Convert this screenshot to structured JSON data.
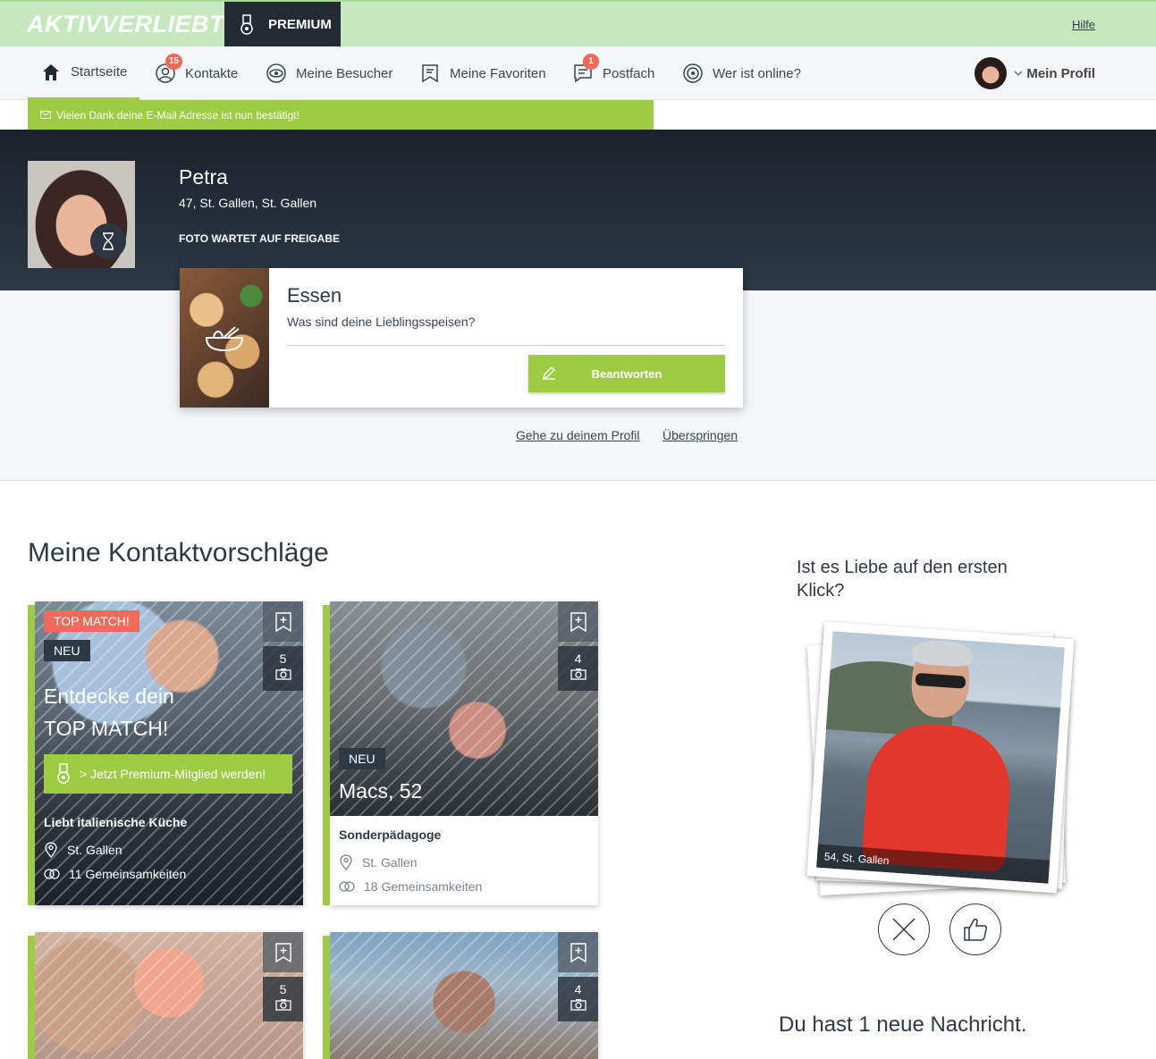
{
  "header": {
    "logo": "AKTIVVERLIEBT",
    "premium_tab": "PREMIUM",
    "help": "Hilfe"
  },
  "nav": {
    "items": [
      {
        "label": "Startseite",
        "icon": "home-icon",
        "active": true
      },
      {
        "label": "Kontakte",
        "icon": "contacts-icon",
        "badge": "15"
      },
      {
        "label": "Meine Besucher",
        "icon": "eye-icon"
      },
      {
        "label": "Meine Favoriten",
        "icon": "bookmark-icon"
      },
      {
        "label": "Postfach",
        "icon": "message-icon",
        "badge": "1"
      },
      {
        "label": "Wer ist online?",
        "icon": "radar-icon"
      }
    ],
    "profile_menu": "Mein Profil"
  },
  "notice": "Vielen Dank deine E-Mail Adresse ist nun bestätigt!",
  "profile": {
    "name": "Petra",
    "location": "47, St. Gallen, St. Gallen",
    "status": "FOTO WARTET AUF FREIGABE"
  },
  "question": {
    "title": "Essen",
    "text": "Was sind deine Lieblingsspeisen?",
    "answer_label": "Beantworten"
  },
  "links": {
    "go_profile": "Gehe zu deinem Profil",
    "skip": "Überspringen"
  },
  "suggestions": {
    "title": "Meine Kontaktvorschläge",
    "cards": [
      {
        "tag_top": "TOP MATCH!",
        "tag_new": "NEU",
        "photo_count": "5",
        "promo_line1": "Entdecke dein",
        "promo_line2": "TOP MATCH!",
        "cta": "> Jetzt Premium-Mitglied werden!",
        "headline": "Liebt italienische Küche",
        "city": "St. Gallen",
        "commonalities": "11 Gemeinsamkeiten"
      },
      {
        "tag_new": "NEU",
        "photo_count": "4",
        "name": "Macs, 52",
        "headline": "Sonderpädagoge",
        "city": "St. Gallen",
        "commonalities": "18 Gemeinsamkeiten"
      },
      {
        "photo_count": "5"
      },
      {
        "photo_count": "4"
      }
    ]
  },
  "love_at_first_click": {
    "title": "Ist es Liebe auf den ersten Klick?",
    "caption": "54, St. Gallen",
    "no_icon": "close-icon",
    "yes_icon": "thumbs-up-icon"
  },
  "messages": {
    "text": "Du hast 1 neue Nachricht."
  },
  "colors": {
    "accent": "#9dcb43",
    "header_bg": "#c6e8bf",
    "dark": "#232b34",
    "badge": "#f06a5a"
  }
}
